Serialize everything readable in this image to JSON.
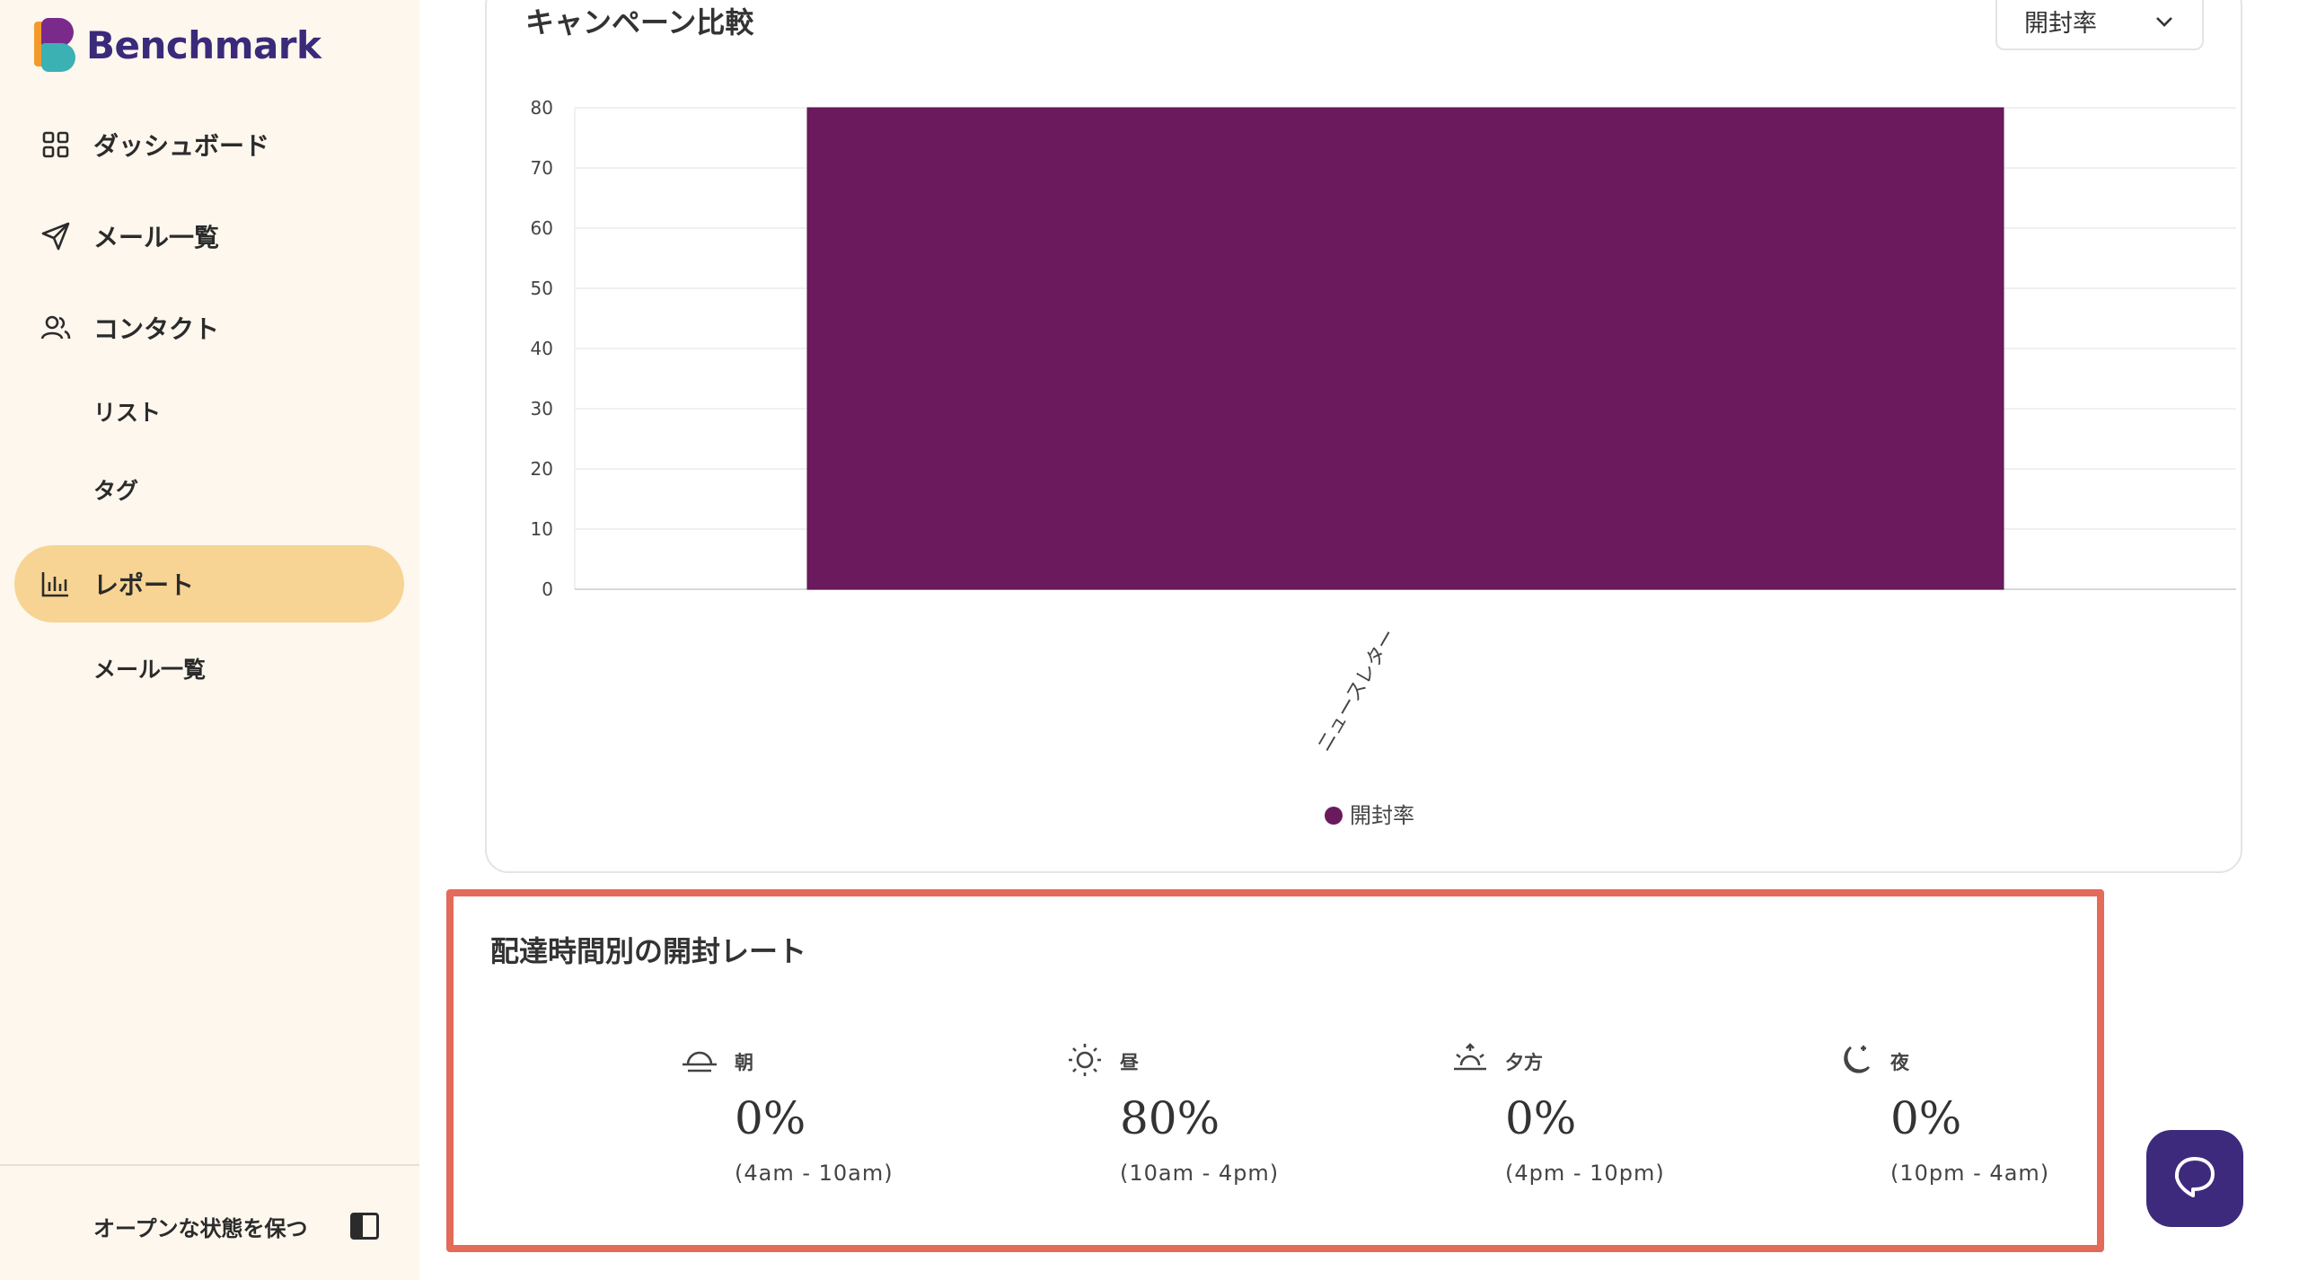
{
  "brand": {
    "name": "Benchmark"
  },
  "sidebar": {
    "items": [
      {
        "label": "ダッシュボード"
      },
      {
        "label": "メール一覧"
      },
      {
        "label": "コンタクト"
      },
      {
        "label": "リスト"
      },
      {
        "label": "タグ"
      },
      {
        "label": "レポート"
      },
      {
        "label": "メール一覧"
      }
    ],
    "keep_open": "オープンな状態を保つ"
  },
  "chart_card": {
    "title": "キャンペーン比較",
    "metric_select": "開封率"
  },
  "chart_data": {
    "type": "bar",
    "categories": [
      "ニュースレター"
    ],
    "series": [
      {
        "name": "開封率",
        "values": [
          80
        ],
        "color": "#6b1a5e"
      }
    ],
    "ylim": [
      0,
      80
    ],
    "yticks": [
      0,
      10,
      20,
      30,
      40,
      50,
      60,
      70,
      80
    ],
    "grid": true,
    "legend": "bottom-center"
  },
  "open_rate_by_time": {
    "title": "配達時間別の開封レート",
    "slots": [
      {
        "label": "朝",
        "value": "0%",
        "range": "(4am - 10am)",
        "icon": "sunrise-icon"
      },
      {
        "label": "昼",
        "value": "80%",
        "range": "(10am - 4pm)",
        "icon": "sun-icon"
      },
      {
        "label": "夕方",
        "value": "0%",
        "range": "(4pm - 10pm)",
        "icon": "sunset-icon"
      },
      {
        "label": "夜",
        "value": "0%",
        "range": "(10pm - 4am)",
        "icon": "moon-icon"
      }
    ]
  },
  "colors": {
    "accent": "#f7d493",
    "bar": "#6b1a5e",
    "highlight": "#e46a5a",
    "chat": "#3d2a7d"
  }
}
